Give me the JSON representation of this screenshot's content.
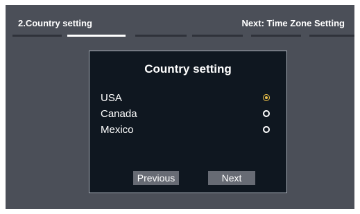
{
  "header": {
    "step_title": "2.Country setting",
    "next_step": "Next: Time Zone Setting"
  },
  "progress": {
    "total_steps": 6,
    "active_step": 2
  },
  "dialog": {
    "title": "Country setting",
    "options": [
      {
        "label": "USA",
        "selected": true
      },
      {
        "label": "Canada",
        "selected": false
      },
      {
        "label": "Mexico",
        "selected": false
      }
    ],
    "previous_label": "Previous",
    "next_label": "Next"
  },
  "colors": {
    "background": "#4b4f58",
    "dialog_bg": "#0f1720",
    "accent": "#f0c44a",
    "button": "#676b74"
  }
}
